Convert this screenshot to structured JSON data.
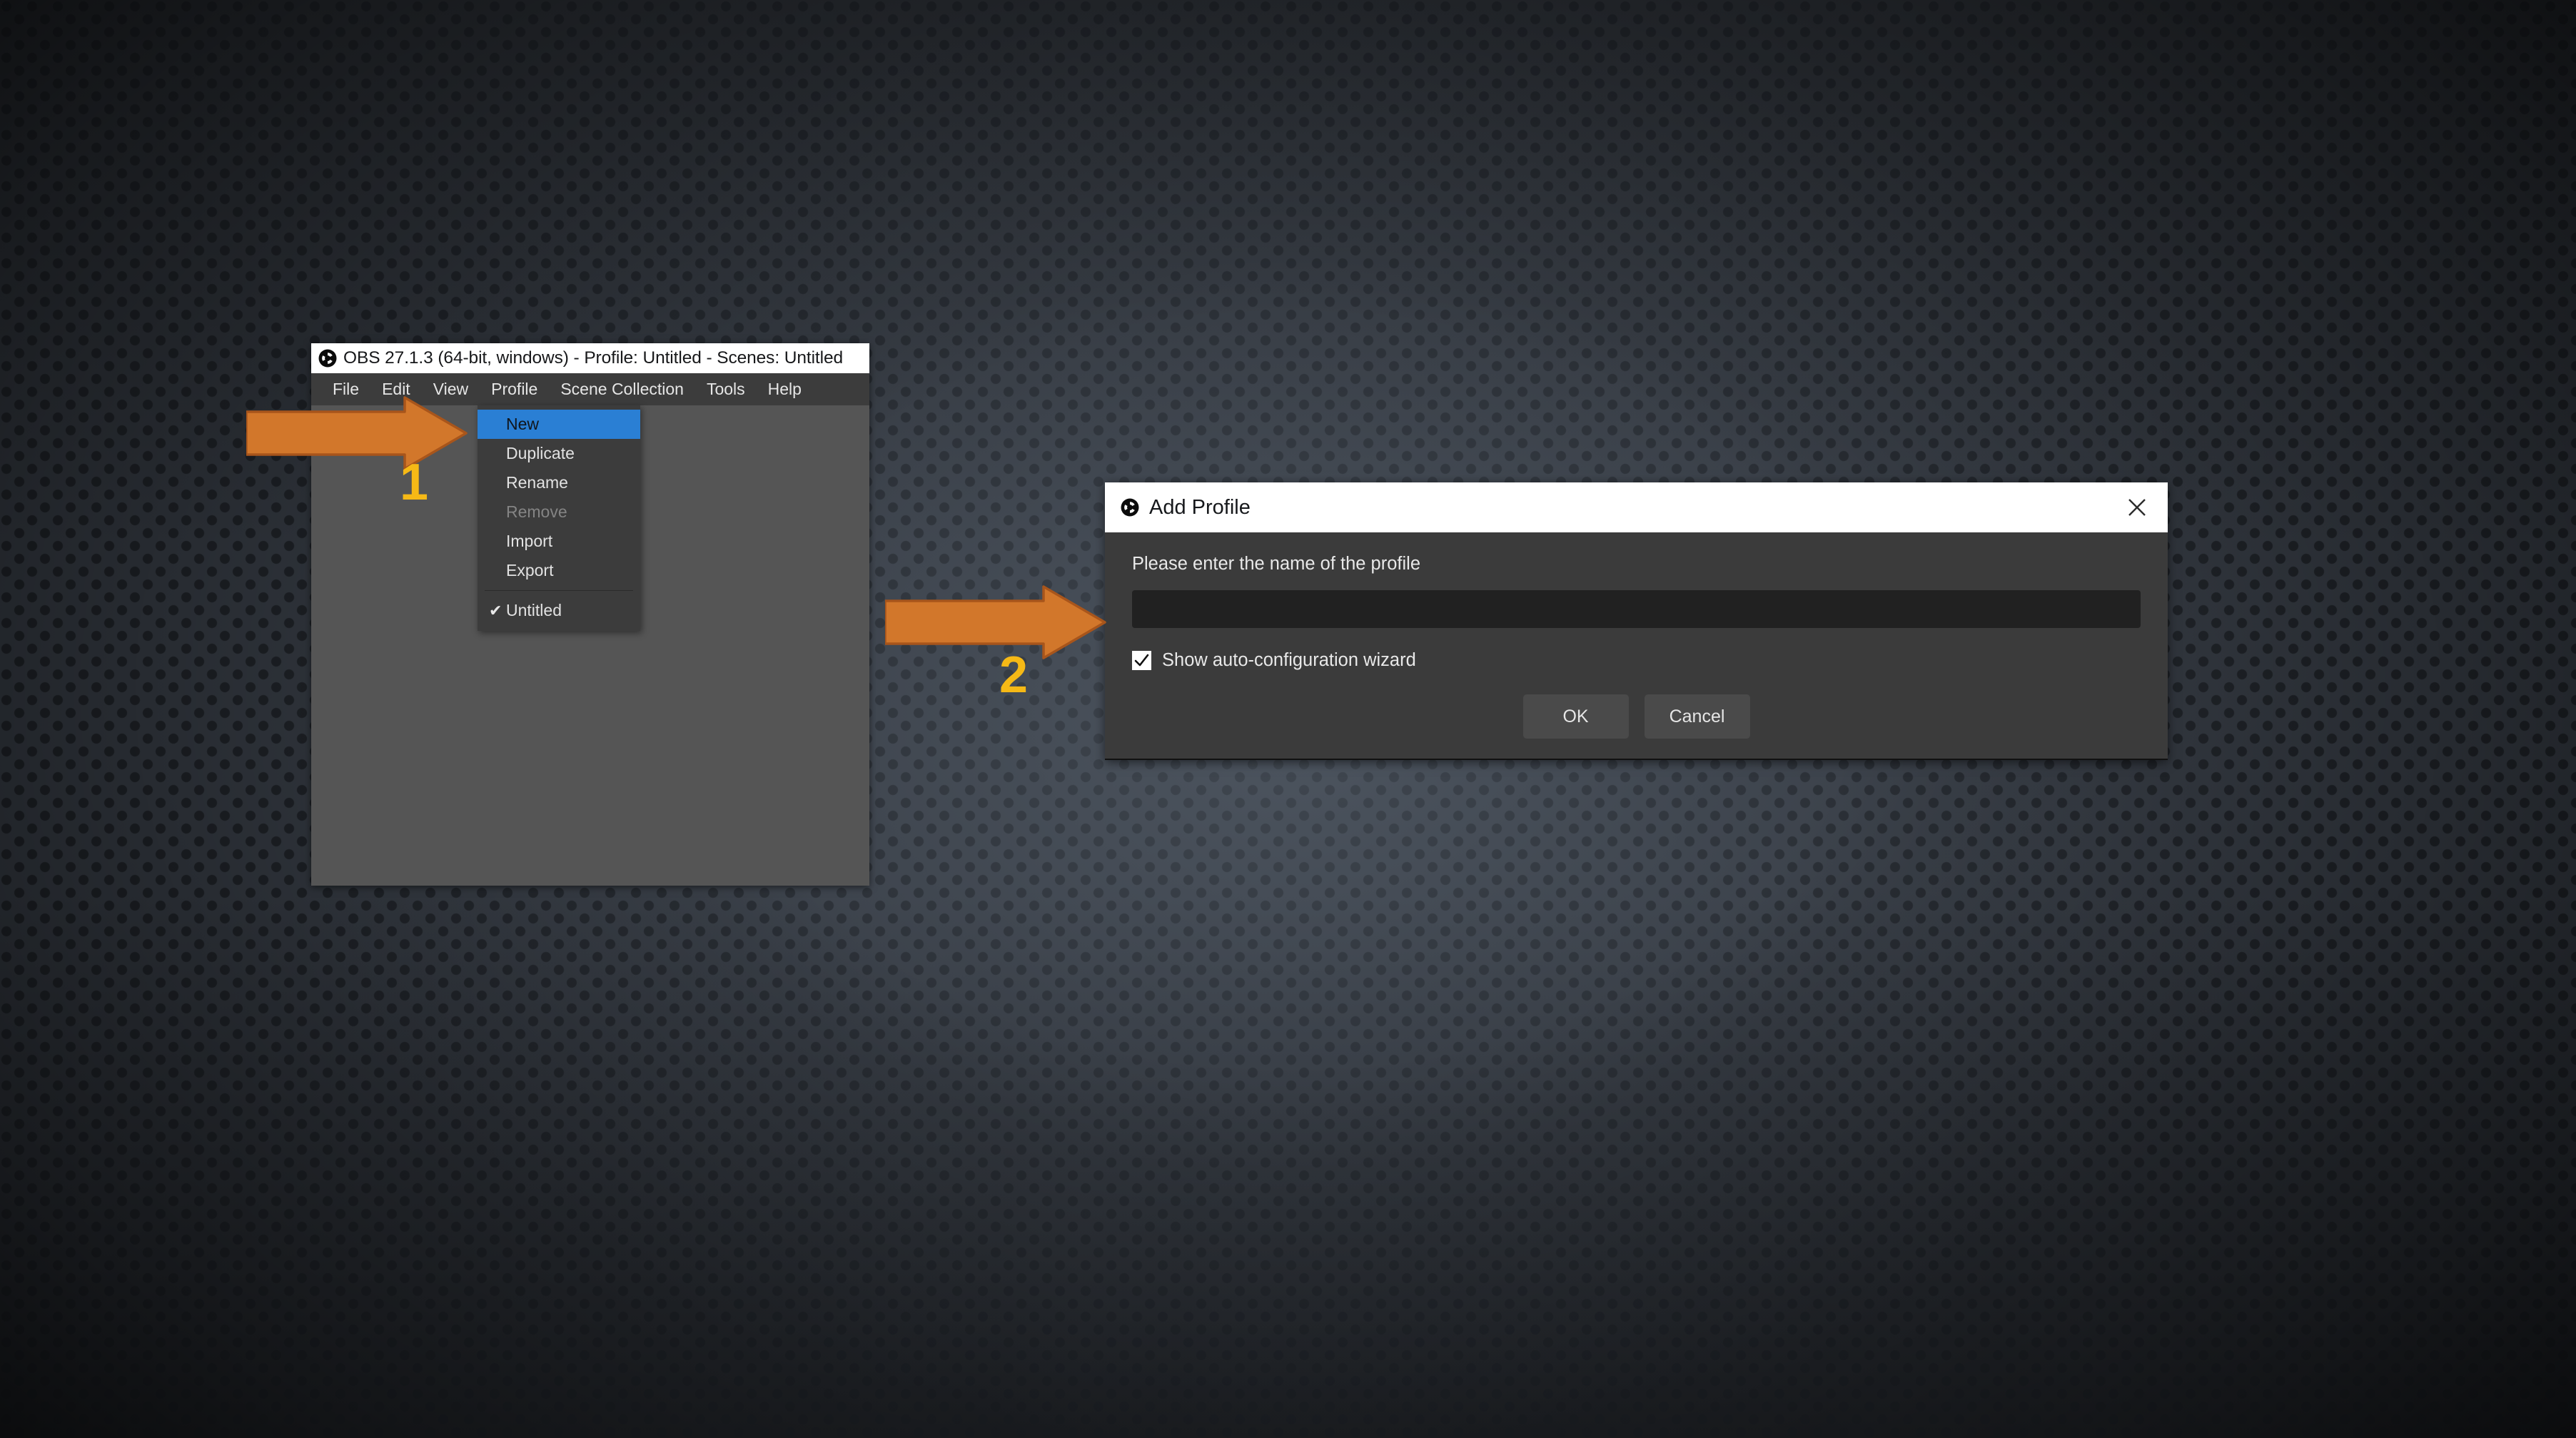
{
  "app": {
    "window_title": "OBS 27.1.3 (64-bit, windows) - Profile: Untitled - Scenes: Untitled",
    "logo_icon": "obs-logo-icon",
    "menubar": [
      {
        "label": "File"
      },
      {
        "label": "Edit"
      },
      {
        "label": "View"
      },
      {
        "label": "Profile"
      },
      {
        "label": "Scene Collection"
      },
      {
        "label": "Tools"
      },
      {
        "label": "Help"
      }
    ]
  },
  "profile_menu": {
    "items": [
      {
        "label": "New",
        "state": "selected"
      },
      {
        "label": "Duplicate",
        "state": "normal"
      },
      {
        "label": "Rename",
        "state": "normal"
      },
      {
        "label": "Remove",
        "state": "disabled"
      },
      {
        "label": "Import",
        "state": "normal"
      },
      {
        "label": "Export",
        "state": "normal"
      }
    ],
    "separator": true,
    "profiles": [
      {
        "label": "Untitled",
        "checked": true,
        "check_glyph": "✔"
      }
    ]
  },
  "dialog": {
    "title": "Add Profile",
    "logo_icon": "obs-logo-icon",
    "close_icon": "close-x-icon",
    "prompt": "Please enter the name of the profile",
    "name_input": {
      "value": "",
      "placeholder": ""
    },
    "checkbox": {
      "label": "Show auto-configuration wizard",
      "checked": true
    },
    "ok_label": "OK",
    "cancel_label": "Cancel"
  },
  "annotations": {
    "steps": [
      {
        "number": "1",
        "target": "profile-menu-new"
      },
      {
        "number": "2",
        "target": "add-profile-dialog"
      }
    ]
  },
  "colors": {
    "arrow_fill": "#d2772b",
    "arrow_stroke": "#a8551b",
    "step_number": "#f6b916",
    "menu_highlight": "#2a7fd4",
    "window_chrome": "#3c3c3c",
    "window_body": "#555555",
    "dialog_body": "#3b3b3b",
    "input_bg": "#212121",
    "button_bg": "#4a4a4a",
    "titlebar_bg": "#ffffff"
  }
}
